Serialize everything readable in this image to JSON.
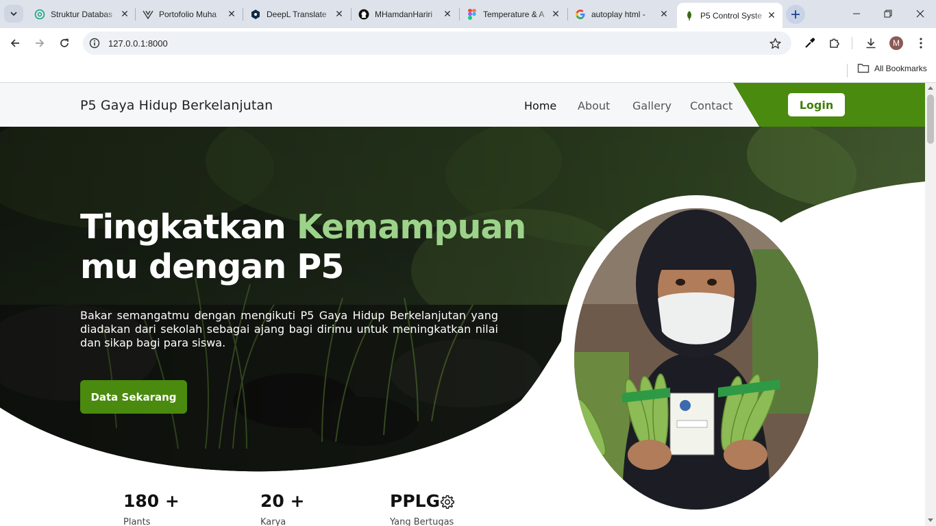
{
  "browser": {
    "tabs": [
      {
        "title": "Struktur Databas",
        "icon": "chatgpt-icon"
      },
      {
        "title": "Portofolio Muha",
        "icon": "vercel-icon"
      },
      {
        "title": "DeepL Translate",
        "icon": "deepl-icon"
      },
      {
        "title": "MHamdanHariri",
        "icon": "github-icon"
      },
      {
        "title": "Temperature & A",
        "icon": "figma-icon"
      },
      {
        "title": "autoplay html - ",
        "icon": "google-icon"
      },
      {
        "title": "P5 Control Syste",
        "icon": "leaf-icon"
      }
    ],
    "active_tab": 6,
    "url": "127.0.0.1:8000",
    "profile_initial": "M",
    "all_bookmarks_label": "All Bookmarks"
  },
  "site": {
    "brand": "P5 Gaya Hidup Berkelanjutan",
    "nav": [
      "Home",
      "About",
      "Gallery",
      "Contact"
    ],
    "active_nav": "Home",
    "login_label": "Login",
    "accent_color": "#4a8a0e",
    "highlight_color": "#9dd28a"
  },
  "hero": {
    "title_part1": "Tingkatkan",
    "title_accent": "Kemampuan",
    "title_line2": "mu dengan P5",
    "description": "Bakar semangatmu dengan mengikuti P5 Gaya Hidup Berkelanjutan yang diadakan dari sekolah sebagai ajang bagi dirimu untuk meningkatkan nilai dan sikap bagi para siswa.",
    "cta_label": "Data Sekarang"
  },
  "stats": [
    {
      "value": "180 +",
      "label": "Plants"
    },
    {
      "value": "20 +",
      "label": "Karya"
    },
    {
      "value": "PPLG",
      "label": "Yang Bertugas",
      "icon": "gear-icon"
    }
  ]
}
